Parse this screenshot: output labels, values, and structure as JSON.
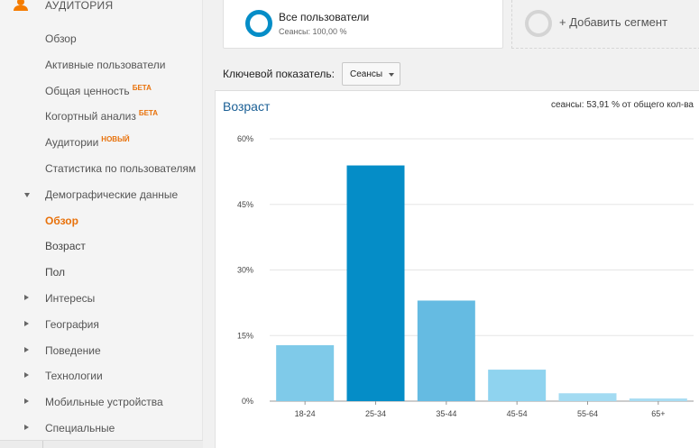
{
  "sidebar": {
    "title": "АУДИТОРИЯ",
    "items": [
      {
        "label": "Обзор",
        "badge": "",
        "type": "plain"
      },
      {
        "label": "Активные пользователи",
        "badge": "",
        "type": "plain"
      },
      {
        "label": "Общая ценность",
        "badge": "БЕТА",
        "type": "plain"
      },
      {
        "label": "Когортный анализ",
        "badge": "БЕТА",
        "type": "plain"
      },
      {
        "label": "Аудитории",
        "badge": "НОВЫЙ",
        "type": "plain"
      },
      {
        "label": "Статистика по пользователям",
        "badge": "",
        "type": "plain"
      },
      {
        "label": "Демографические данные",
        "badge": "",
        "type": "expanded"
      },
      {
        "label": "Обзор",
        "badge": "",
        "type": "active"
      },
      {
        "label": "Возраст",
        "badge": "",
        "type": "sub"
      },
      {
        "label": "Пол",
        "badge": "",
        "type": "sub"
      },
      {
        "label": "Интересы",
        "badge": "",
        "type": "collapsed"
      },
      {
        "label": "География",
        "badge": "",
        "type": "collapsed"
      },
      {
        "label": "Поведение",
        "badge": "",
        "type": "collapsed"
      },
      {
        "label": "Технологии",
        "badge": "",
        "type": "collapsed"
      },
      {
        "label": "Мобильные устройства",
        "badge": "",
        "type": "collapsed"
      },
      {
        "label": "Специальные",
        "badge": "",
        "type": "collapsed"
      }
    ]
  },
  "segment": {
    "name": "Все пользователи",
    "sub": "Сеансы: 100,00 %",
    "ring_color": "#058dc7",
    "add_label": "+ Добавить сегмент"
  },
  "metric": {
    "label": "Ключевой показатель:",
    "value": "Сеансы"
  },
  "chart": {
    "title": "Возраст",
    "note": "сеансы: 53,91 % от общего кол-ва"
  },
  "chart_data": {
    "type": "bar",
    "categories": [
      "18-24",
      "25-34",
      "35-44",
      "45-54",
      "55-64",
      "65+"
    ],
    "values": [
      12.8,
      53.91,
      23.0,
      7.2,
      1.8,
      0.6
    ],
    "colors": [
      "#7fcae9",
      "#058dc7",
      "#65bbe2",
      "#8fd3ef",
      "#a3dbf2",
      "#a7dcf2"
    ],
    "ytick_labels": [
      "0%",
      "15%",
      "30%",
      "45%",
      "60%"
    ],
    "yticks": [
      0,
      15,
      30,
      45,
      60
    ],
    "ylim": [
      0,
      60
    ],
    "grid": true,
    "title": "Возраст",
    "xlabel": "",
    "ylabel": ""
  }
}
